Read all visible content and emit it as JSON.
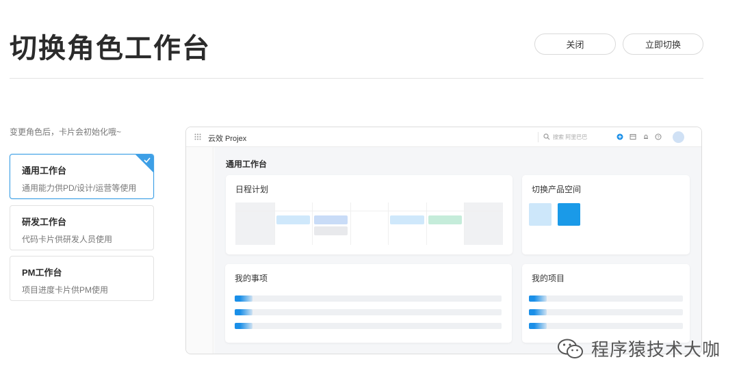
{
  "header": {
    "title": "切换角色工作台",
    "close_label": "关闭",
    "switch_label": "立即切换"
  },
  "hint": "变更角色后，卡片会初始化哦~",
  "roles": [
    {
      "name": "通用工作台",
      "desc": "通用能力供PD/设计/运营等使用",
      "selected": true
    },
    {
      "name": "研发工作台",
      "desc": "代码卡片供研发人员使用",
      "selected": false
    },
    {
      "name": "PM工作台",
      "desc": "项目进度卡片供PM使用",
      "selected": false
    }
  ],
  "preview": {
    "brand": "云效 Projex",
    "search_placeholder": "搜索 阿里巴巴",
    "workspace_title": "通用工作台",
    "widgets": {
      "schedule": "日程计划",
      "product_space": "切换产品空间",
      "my_tasks": "我的事项",
      "my_projects": "我的项目"
    }
  },
  "colors": {
    "accent": "#1a8fe8",
    "selected_border": "#3d9fe6"
  },
  "watermark": {
    "text": "程序猿技术大咖",
    "icon": "wechat-icon"
  }
}
